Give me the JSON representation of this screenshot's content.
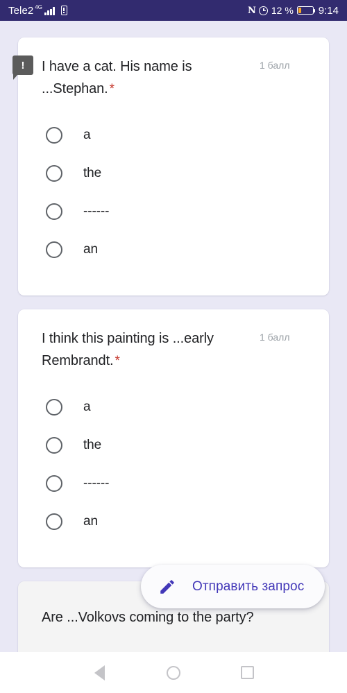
{
  "status_bar": {
    "carrier": "Tele2",
    "network_type": "4G",
    "nfc_icon": "nfc-icon",
    "alarm_icon": "alarm-clock-icon",
    "battery_percent": "12 %",
    "battery_level": 12,
    "battery_color": "#f5a623",
    "time": "9:14",
    "background": "#322b6f"
  },
  "theme": {
    "page_background": "#e9e8f5",
    "card_background": "#ffffff",
    "accent": "#4237b8",
    "required_star": "#c5372c",
    "points_text": "#9aa0a6"
  },
  "questions": [
    {
      "text": "I have a cat. His name is ...Stephan.",
      "required_mark": "*",
      "points": "1 балл",
      "options": [
        {
          "label": "a",
          "selected": false
        },
        {
          "label": "the",
          "selected": false
        },
        {
          "label": "------",
          "selected": false
        },
        {
          "label": "an",
          "selected": false
        }
      ]
    },
    {
      "text": "I think this painting is ...early Rembrandt.",
      "required_mark": "*",
      "points": "1 балл",
      "options": [
        {
          "label": "a",
          "selected": false
        },
        {
          "label": "the",
          "selected": false
        },
        {
          "label": "------",
          "selected": false
        },
        {
          "label": "an",
          "selected": false
        }
      ]
    },
    {
      "text": "Are ...Volkovs coming to the party?",
      "required_mark": "",
      "points": "",
      "options": []
    }
  ],
  "error_tooltip": {
    "glyph": "!",
    "background": "#5b5b5b"
  },
  "fab": {
    "label": "Отправить запрос",
    "icon": "pencil-icon",
    "color": "#4237b8"
  },
  "navbar": {
    "back_icon": "back-triangle-icon",
    "home_icon": "home-circle-icon",
    "recents_icon": "recents-square-icon"
  }
}
